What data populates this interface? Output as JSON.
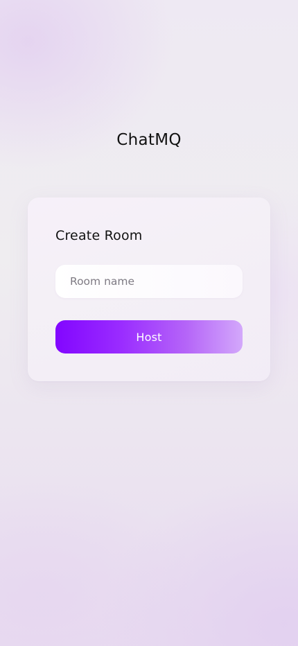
{
  "app": {
    "title": "ChatMQ"
  },
  "create_room": {
    "title": "Create Room",
    "room_name_input": {
      "value": "",
      "placeholder": "Room name"
    },
    "host_button_label": "Host"
  },
  "colors": {
    "accent_start": "#8206ff",
    "accent_end": "#d3a8fb"
  }
}
